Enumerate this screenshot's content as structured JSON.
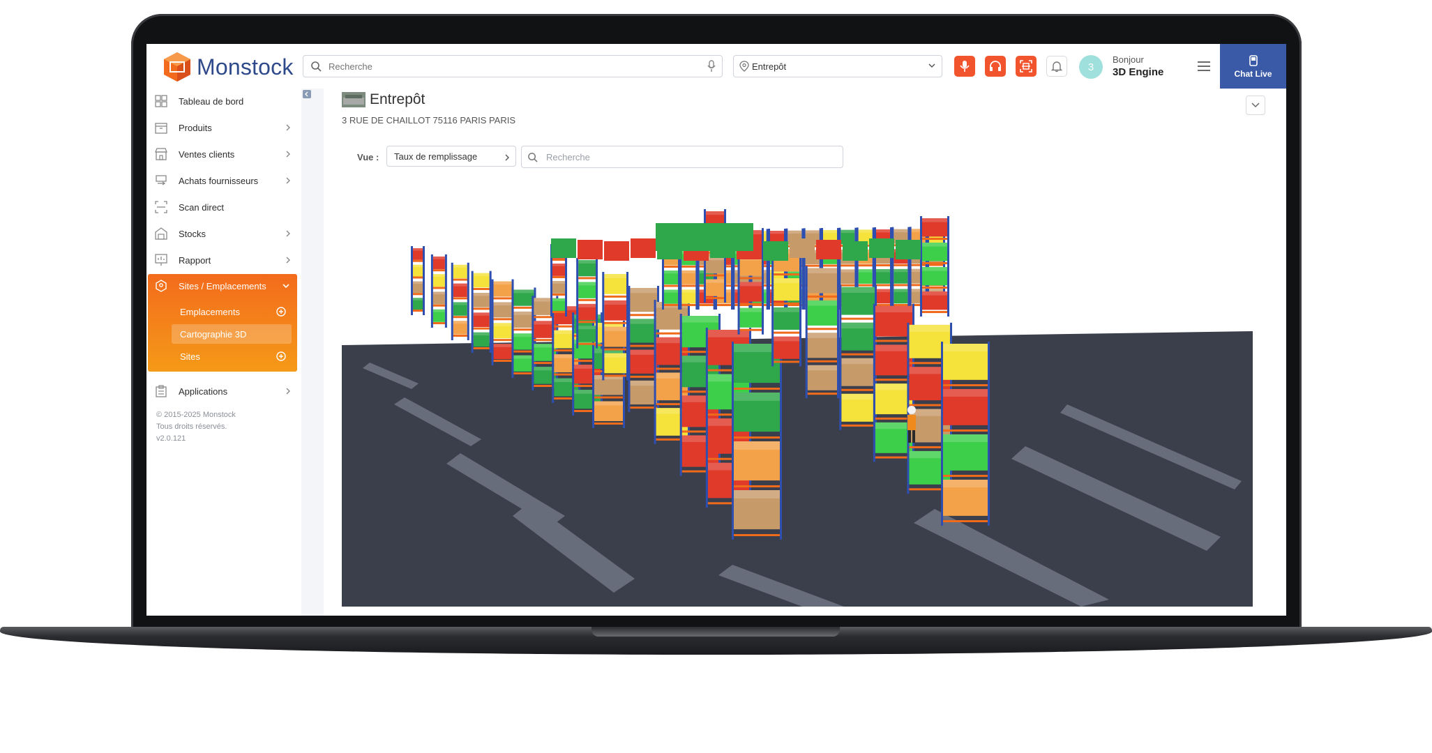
{
  "brand": {
    "name": "Monstock",
    "logo_color": "#f26a1b",
    "text_color": "#2f4a8a"
  },
  "topbar": {
    "search_placeholder": "Recherche",
    "location_value": "Entrepôt",
    "icons": [
      "microphone-icon",
      "headset-icon",
      "scan-icon",
      "bell-icon"
    ],
    "accent_color": "#f2542d"
  },
  "user": {
    "avatar_initial": "3",
    "greeting": "Bonjour",
    "name": "3D Engine"
  },
  "chat": {
    "label": "Chat Live",
    "color": "#3a5aa8"
  },
  "sidebar": {
    "items": [
      {
        "label": "Tableau de bord",
        "icon": "dashboard-icon",
        "has_arrow": false
      },
      {
        "label": "Produits",
        "icon": "box-icon",
        "has_arrow": true
      },
      {
        "label": "Ventes clients",
        "icon": "store-icon",
        "has_arrow": true
      },
      {
        "label": "Achats fournisseurs",
        "icon": "supplier-icon",
        "has_arrow": true
      },
      {
        "label": "Scan direct",
        "icon": "scan-icon",
        "has_arrow": false
      },
      {
        "label": "Stocks",
        "icon": "warehouse-icon",
        "has_arrow": true
      },
      {
        "label": "Rapport",
        "icon": "report-icon",
        "has_arrow": true
      }
    ],
    "active_group": {
      "label": "Sites / Emplacements",
      "icon": "location-icon",
      "children": [
        {
          "label": "Emplacements",
          "has_plus": true,
          "active": false
        },
        {
          "label": "Cartographie 3D",
          "has_plus": false,
          "active": true
        },
        {
          "label": "Sites",
          "has_plus": true,
          "active": false
        }
      ]
    },
    "after_items": [
      {
        "label": "Applications",
        "icon": "clipboard-icon",
        "has_arrow": true
      }
    ],
    "footer": [
      "© 2015-2025 Monstock",
      "Tous droits réservés.",
      "v2.0.121"
    ]
  },
  "main": {
    "title": "Entrepôt",
    "address": "3 RUE DE CHAILLOT 75116 PARIS PARIS",
    "view_label": "Vue :",
    "view_value": "Taux de remplissage",
    "search_placeholder": "Recherche",
    "scene": {
      "type": "3d-warehouse-rack-view",
      "floor_color": "#3b3f4c",
      "rack_color": "#2e4fb0",
      "beam_color": "#f06a1c",
      "box_colors": [
        "#c79a6a",
        "#2ea84a",
        "#e03a2a",
        "#f5e23a",
        "#f3a24a",
        "#3ecf4a"
      ]
    }
  }
}
